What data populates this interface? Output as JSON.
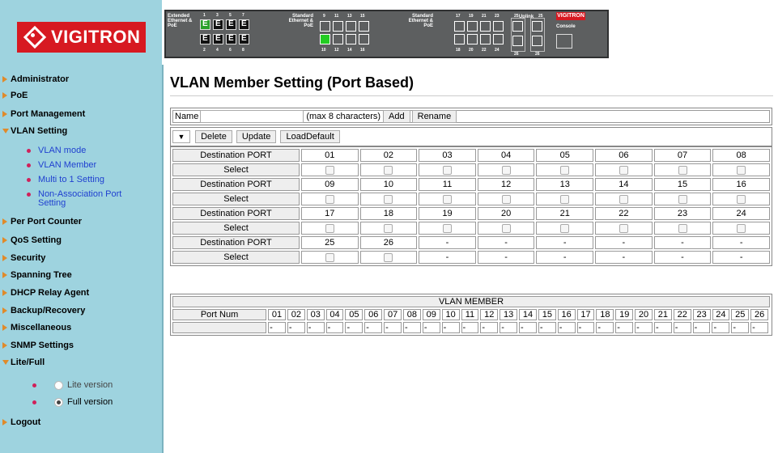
{
  "brand": {
    "name": "VIGITRON",
    "color": "#d71921"
  },
  "faceplate": {
    "group1_label": "Extended Ethernet & PoE",
    "group2_label": "Standard Ethernet & PoE",
    "group3_label": "Standard Ethernet & PoE",
    "uplink_label": "Uplink",
    "console_label": "Console",
    "brand": "VIGITRON",
    "top_nums_1": [
      "1",
      "3",
      "5",
      "7"
    ],
    "bot_nums_1": [
      "2",
      "4",
      "6",
      "8"
    ],
    "top_nums_2": [
      "9",
      "11",
      "13",
      "15"
    ],
    "bot_nums_2": [
      "10",
      "12",
      "14",
      "16"
    ],
    "top_nums_3": [
      "17",
      "19",
      "21",
      "23"
    ],
    "bot_nums_3": [
      "18",
      "20",
      "22",
      "24"
    ],
    "uplink_top": [
      "25",
      "25"
    ],
    "uplink_bot": [
      "26",
      "26"
    ]
  },
  "sidebar": {
    "items": [
      {
        "label": "Administrator"
      },
      {
        "label": "PoE"
      },
      {
        "label": "Port Management"
      },
      {
        "label": "VLAN Setting"
      },
      {
        "label": "Per Port Counter"
      },
      {
        "label": "QoS Setting"
      },
      {
        "label": "Security"
      },
      {
        "label": "Spanning Tree"
      },
      {
        "label": "DHCP Relay Agent"
      },
      {
        "label": "Backup/Recovery"
      },
      {
        "label": "Miscellaneous"
      },
      {
        "label": "SNMP Settings"
      },
      {
        "label": "Lite/Full"
      },
      {
        "label": "Logout"
      }
    ],
    "vlan_sub": [
      "VLAN mode",
      "VLAN Member",
      "Multi to 1 Setting",
      "Non-Association Port Setting"
    ],
    "lite_label": "Lite version",
    "full_label": "Full version",
    "selected_mode": "Full version"
  },
  "main": {
    "title": "VLAN Member Setting (Port Based)",
    "name_label": "Name",
    "name_value": "",
    "max_hint": "(max 8 characters)",
    "add_label": "Add",
    "rename_label": "Rename",
    "select_value": "",
    "delete_label": "Delete",
    "update_label": "Update",
    "loaddefault_label": "LoadDefault",
    "dest_port_label": "Destination PORT",
    "select_label": "Select",
    "port_rows": [
      [
        "01",
        "02",
        "03",
        "04",
        "05",
        "06",
        "07",
        "08"
      ],
      [
        "09",
        "10",
        "11",
        "12",
        "13",
        "14",
        "15",
        "16"
      ],
      [
        "17",
        "18",
        "19",
        "20",
        "21",
        "22",
        "23",
        "24"
      ],
      [
        "25",
        "26",
        "-",
        "-",
        "-",
        "-",
        "-",
        "-"
      ]
    ],
    "member_title": "VLAN MEMBER",
    "port_num_label": "Port Num",
    "member_ports": [
      "01",
      "02",
      "03",
      "04",
      "05",
      "06",
      "07",
      "08",
      "09",
      "10",
      "11",
      "12",
      "13",
      "14",
      "15",
      "16",
      "17",
      "18",
      "19",
      "20",
      "21",
      "22",
      "23",
      "24",
      "25",
      "26"
    ],
    "member_values": [
      "-",
      "-",
      "-",
      "-",
      "-",
      "-",
      "-",
      "-",
      "-",
      "-",
      "-",
      "-",
      "-",
      "-",
      "-",
      "-",
      "-",
      "-",
      "-",
      "-",
      "-",
      "-",
      "-",
      "-",
      "-",
      "-"
    ]
  }
}
